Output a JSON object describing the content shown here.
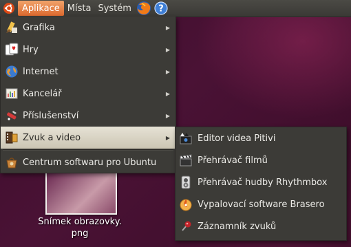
{
  "panel": {
    "applications": "Aplikace",
    "places": "Místa",
    "system": "Systém"
  },
  "apps_menu": [
    {
      "label": "Grafika",
      "icon": "graphics-icon",
      "has_submenu": true
    },
    {
      "label": "Hry",
      "icon": "games-icon",
      "has_submenu": true
    },
    {
      "label": "Internet",
      "icon": "internet-globe-icon",
      "has_submenu": true
    },
    {
      "label": "Kancelář",
      "icon": "office-icon",
      "has_submenu": true
    },
    {
      "label": "Příslušenství",
      "icon": "accessories-icon",
      "has_submenu": true
    },
    {
      "label": "Zvuk a video",
      "icon": "sound-video-icon",
      "has_submenu": true,
      "active": true
    },
    {
      "label": "Centrum softwaru pro Ubuntu",
      "icon": "software-center-icon",
      "has_submenu": false
    }
  ],
  "sound_submenu": [
    {
      "label": "Editor videa Pitivi",
      "icon": "pitivi-icon"
    },
    {
      "label": "Přehrávač filmů",
      "icon": "movie-player-icon"
    },
    {
      "label": "Přehrávač hudby Rhythmbox",
      "icon": "rhythmbox-icon"
    },
    {
      "label": "Vypalovací software Brasero",
      "icon": "brasero-icon"
    },
    {
      "label": "Záznamník zvuků",
      "icon": "sound-recorder-icon"
    }
  ],
  "desktop": {
    "file_label_line1": "Snímek obrazovky.",
    "file_label_line2": "png"
  },
  "colors": {
    "applications_highlight": "#dd6a2f",
    "menu_background": "#3c3b37",
    "active_item": "#d8d3c4"
  }
}
